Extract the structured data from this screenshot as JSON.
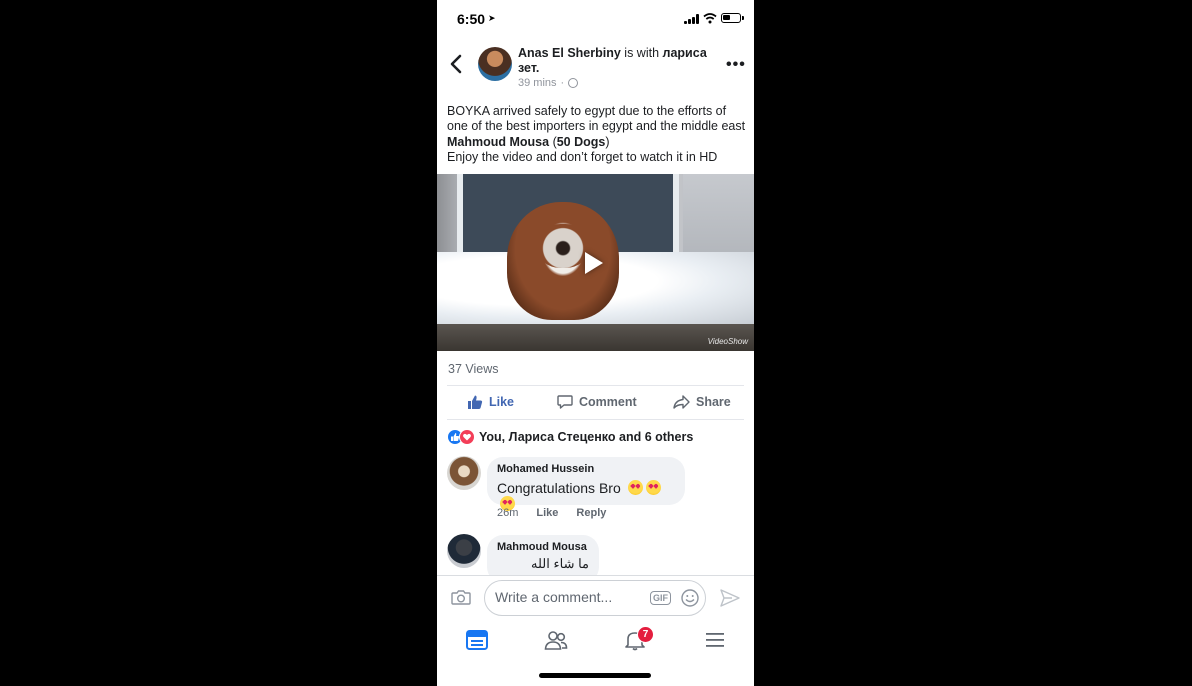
{
  "status_bar": {
    "time": "6:50"
  },
  "post": {
    "author": "Anas El Sherbiny",
    "with_text": "is with",
    "tagged": "лариса",
    "tagged_line2": "зет.",
    "time_ago": "39 mins",
    "separator": "·",
    "text_line1": "BOYKA arrived safely to egypt due to the efforts of",
    "text_line2": "one of the best importers in egypt and the middle east",
    "text_line3_name": "Mahmoud Mousa",
    "text_line3_paren_open": " (",
    "text_line3_page": "50 Dogs",
    "text_line3_paren_close": ")",
    "text_line4": "Enjoy the video and don’t forget to watch it in HD",
    "video_watermark": "VideoShow",
    "views": "37 Views"
  },
  "actions": {
    "like": "Like",
    "comment": "Comment",
    "share": "Share"
  },
  "reactions": {
    "summary": "You, Лариса Стеценко and 6 others"
  },
  "comments": [
    {
      "name": "Mohamed Hussein",
      "text": "Congratulations Bro",
      "emoji_count": 3,
      "time": "26m",
      "like": "Like",
      "reply": "Reply"
    },
    {
      "name": "Mahmoud Mousa",
      "text": "ما شاء الله"
    }
  ],
  "composer": {
    "placeholder": "Write a comment...",
    "gif_label": "GIF"
  },
  "tabbar": {
    "notification_badge": "7"
  },
  "colors": {
    "facebook_blue": "#4267b2",
    "badge_red": "#e41e3f",
    "love_red": "#f33e58"
  }
}
